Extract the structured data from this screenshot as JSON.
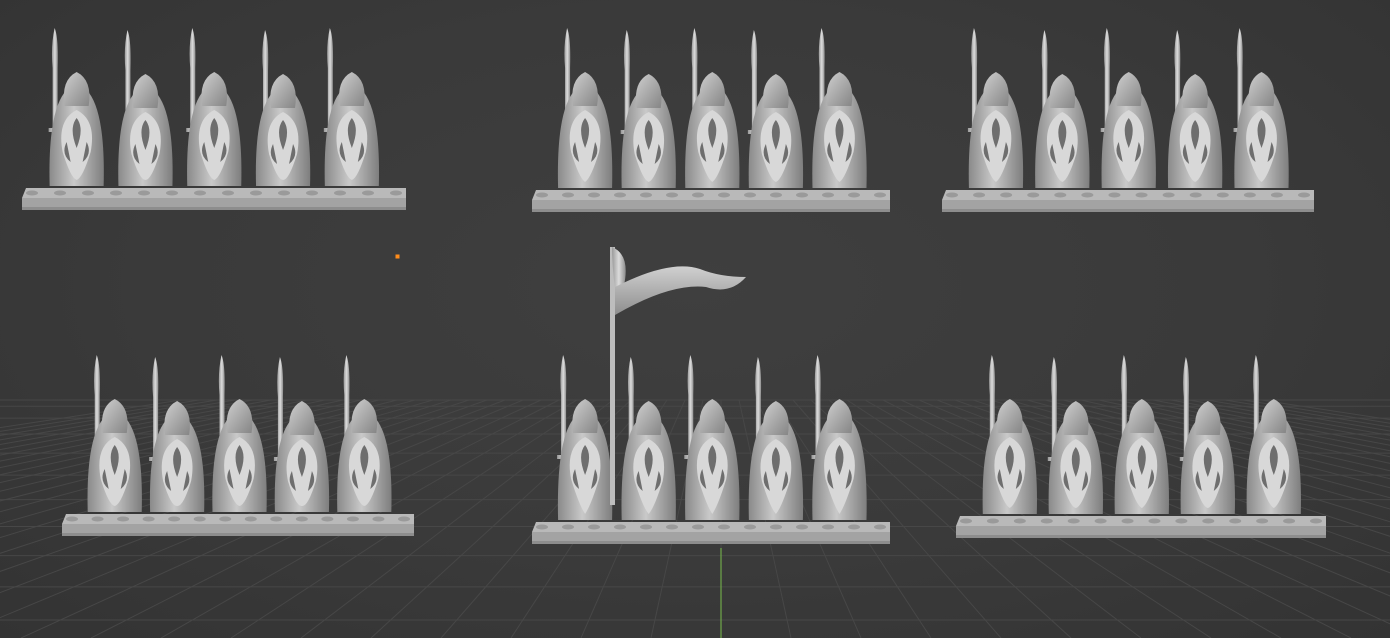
{
  "viewport": {
    "background": "#3a3a3a",
    "grid_color": "#474747",
    "y_axis_color": "#6fa84a",
    "origin_marker_color": "#ff8c1a"
  },
  "regiments": [
    {
      "id": "regiment-1",
      "figures": 5,
      "type": "infantry"
    },
    {
      "id": "regiment-2",
      "figures": 5,
      "type": "infantry"
    },
    {
      "id": "regiment-3",
      "figures": 5,
      "type": "infantry"
    },
    {
      "id": "regiment-4",
      "figures": 5,
      "type": "infantry"
    },
    {
      "id": "regiment-5",
      "figures": 5,
      "type": "command"
    },
    {
      "id": "regiment-6",
      "figures": 5,
      "type": "infantry"
    }
  ]
}
